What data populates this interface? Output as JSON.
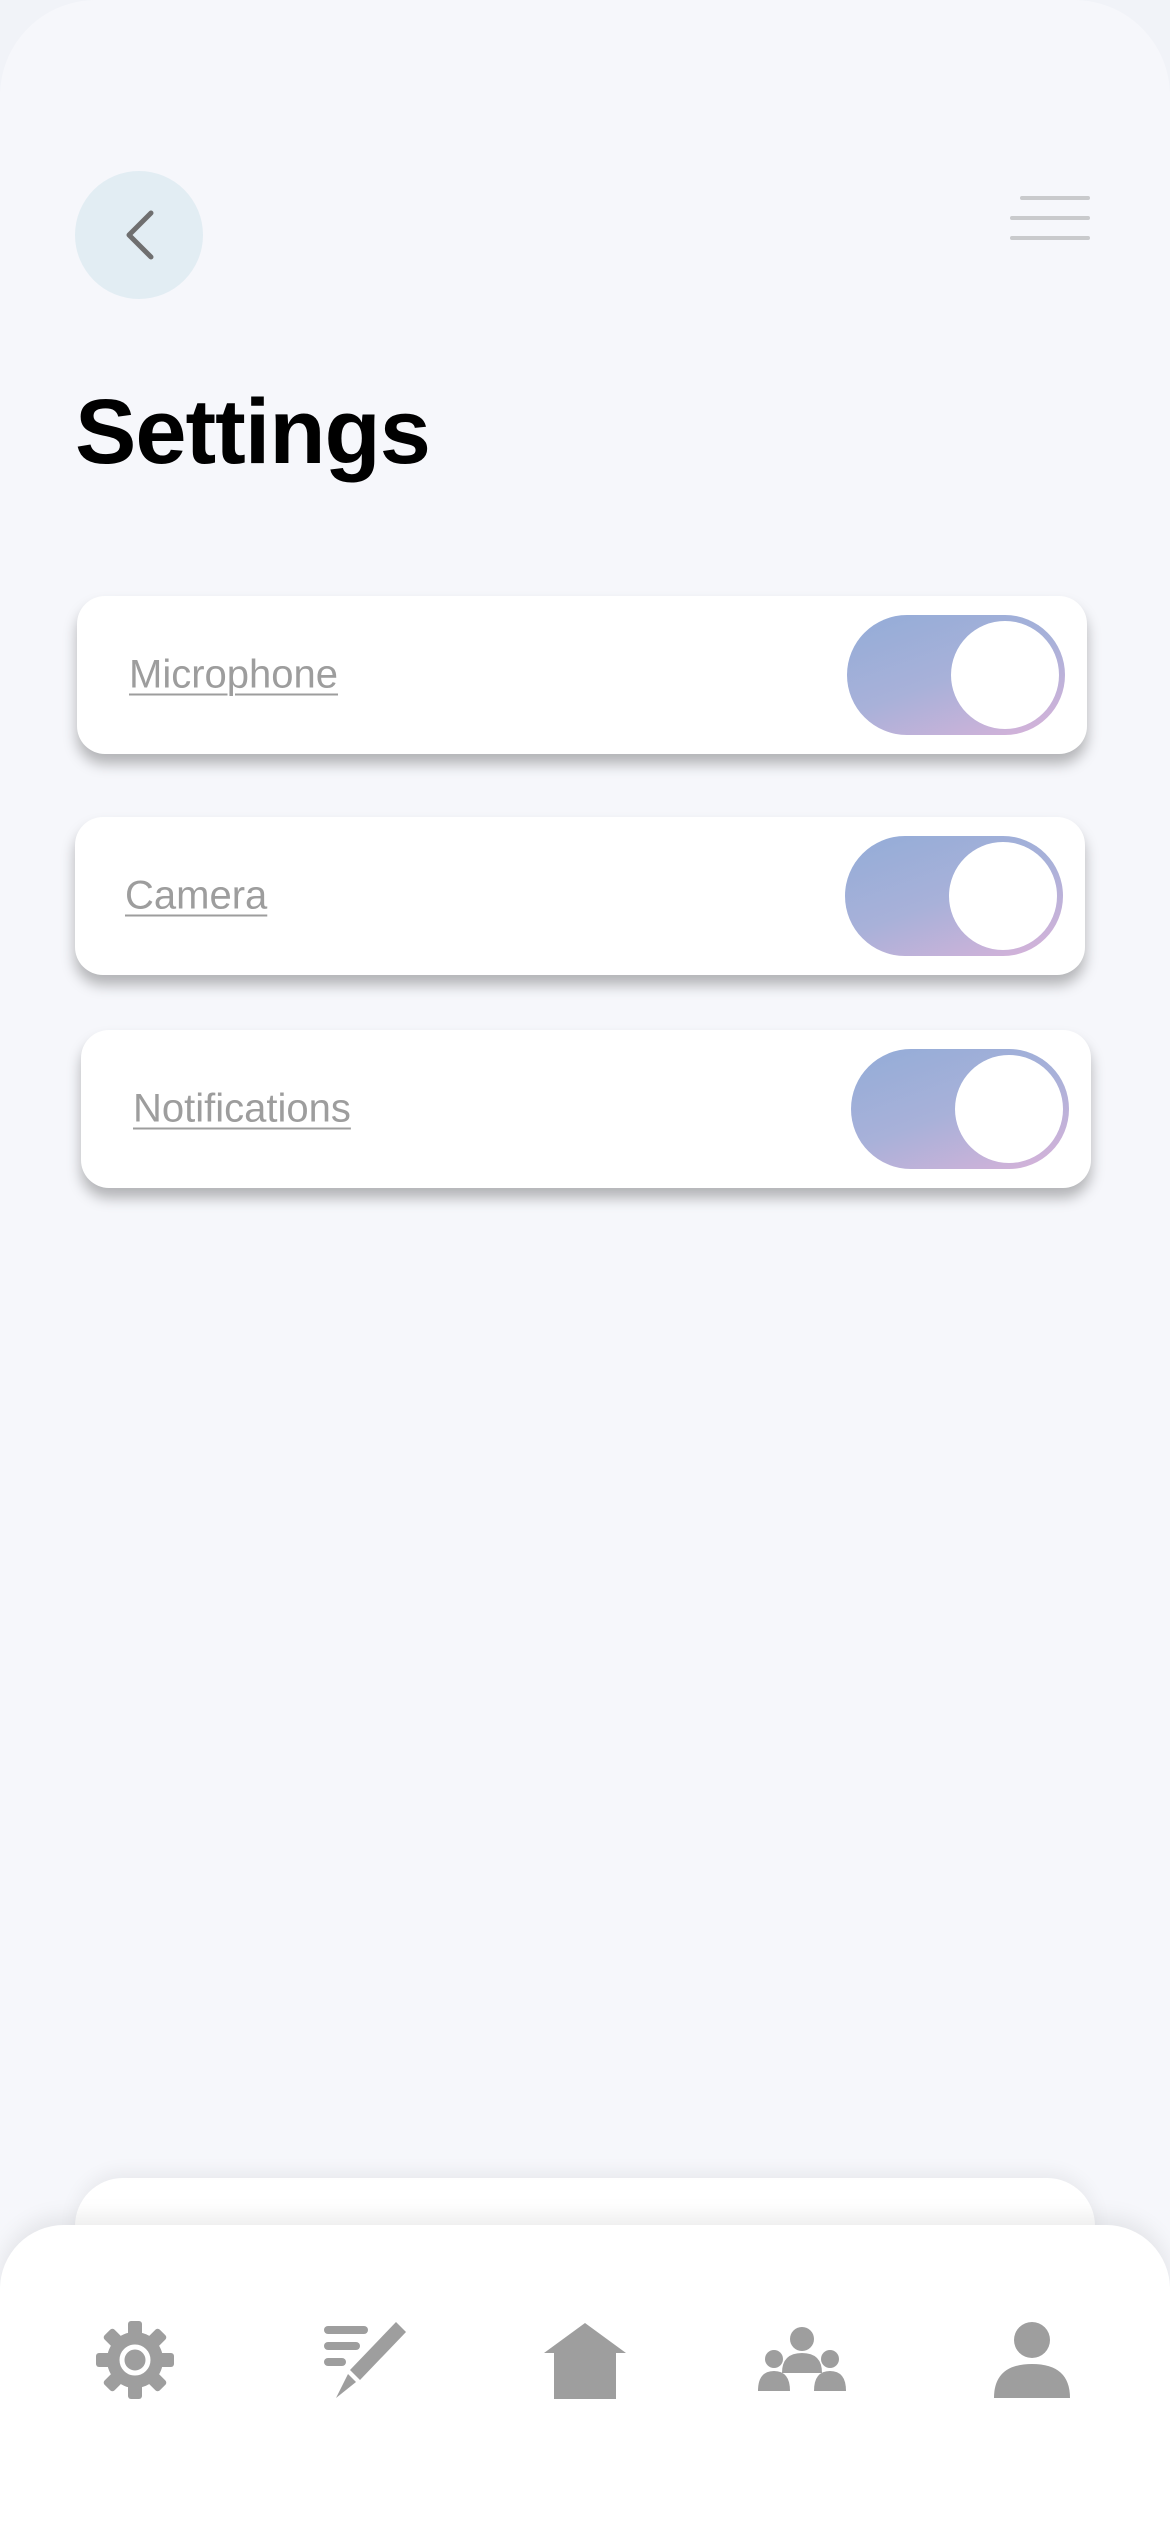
{
  "header": {
    "title": "Settings",
    "back_icon": "chevron-left-icon",
    "menu_icon": "menu-icon"
  },
  "settings": [
    {
      "label": "Microphone",
      "enabled": true
    },
    {
      "label": "Camera",
      "enabled": true
    },
    {
      "label": "Notifications",
      "enabled": true
    }
  ],
  "tabbar": {
    "items": [
      {
        "icon": "gear-icon"
      },
      {
        "icon": "edit-icon"
      },
      {
        "icon": "home-icon"
      },
      {
        "icon": "group-icon"
      },
      {
        "icon": "profile-icon"
      }
    ]
  },
  "colors": {
    "background": "#f6f7fb",
    "card": "#ffffff",
    "toggle_gradient_start": "#93acd8",
    "toggle_gradient_end": "#d9b2d9",
    "icon_gray": "#9e9e9e",
    "label_gray": "#9d9d9d"
  }
}
